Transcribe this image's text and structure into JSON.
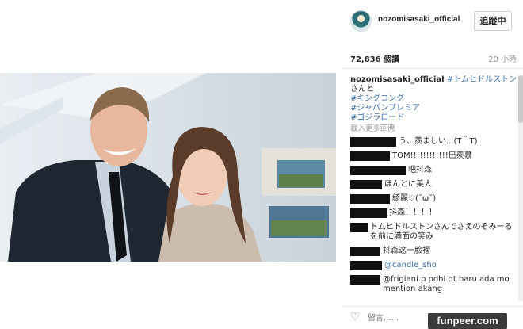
{
  "header": {
    "username": "nozomisasaki_official",
    "follow_label": "追蹤中"
  },
  "stats": {
    "likes": "72,836 個讚",
    "time": "20 小時"
  },
  "caption": {
    "owner": "nozomisasaki_official",
    "lines": [
      "#トムヒドルストン",
      "さんと",
      "#キングコング",
      "#ジャパンプレミア",
      "#ゴジラロード"
    ]
  },
  "load_more": "載入更多回應",
  "comments": [
    {
      "text": "う、羨ましい...(T＾T)"
    },
    {
      "text": "TOM!!!!!!!!!!!!巴羨慕"
    },
    {
      "text": "吧抖森"
    },
    {
      "text": "ほんとに美人"
    },
    {
      "text": "綺麗♡(˘ω˘)"
    },
    {
      "text": "抖森！！！！"
    },
    {
      "text": "トムヒドルストンさんでさえのぞみーるを前に満面の笑み"
    },
    {
      "text": "抖森这一脸褶"
    },
    {
      "text": "@candle_sho"
    },
    {
      "text": "@frigiani.p pdhl qt baru ada mo mention akang"
    }
  ],
  "comment_input": {
    "placeholder": "留言......"
  },
  "icons": {
    "like": "heart-icon"
  },
  "watermark": "funpeer.com"
}
